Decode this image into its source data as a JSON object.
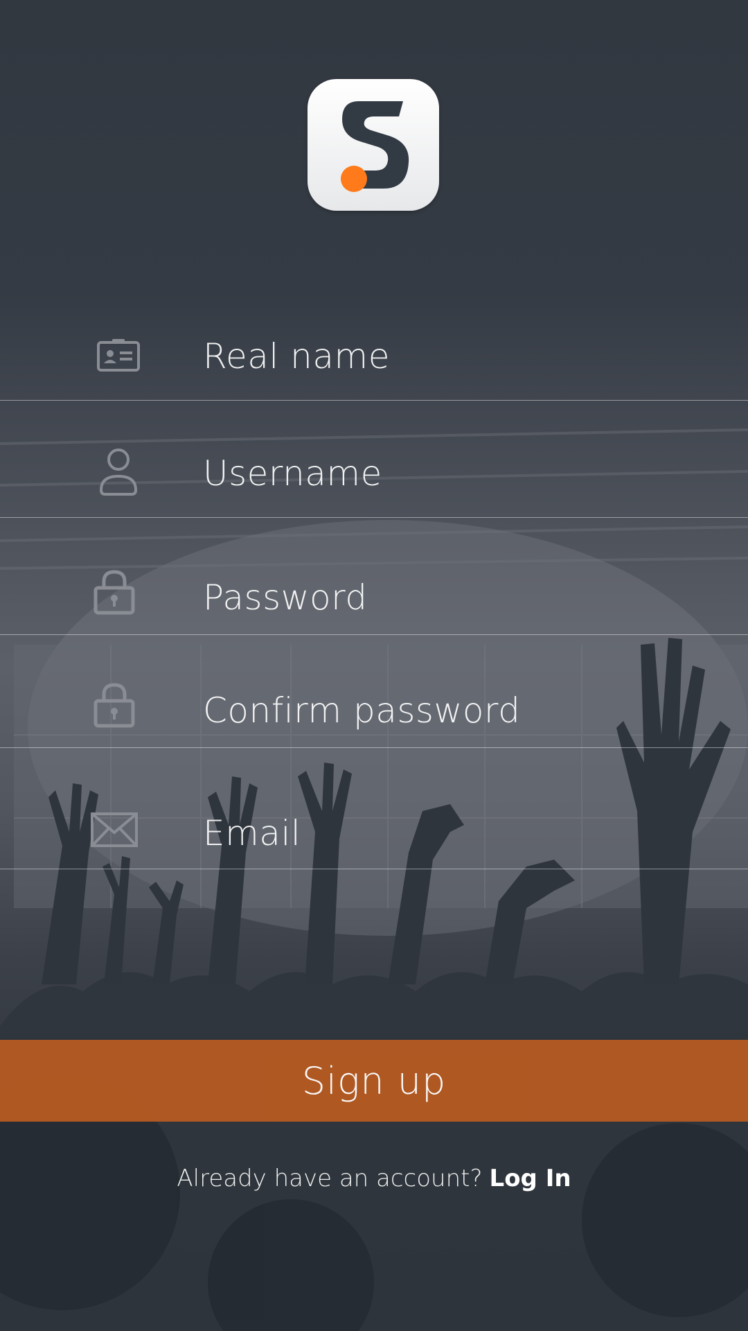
{
  "app": {
    "logo_letter": "S",
    "accent_color": "#ff7a1a",
    "button_color": "#b45a22"
  },
  "form": {
    "fields": [
      {
        "name": "real-name",
        "icon": "id-card-icon",
        "placeholder": "Real name"
      },
      {
        "name": "username",
        "icon": "user-icon",
        "placeholder": "Username"
      },
      {
        "name": "password",
        "icon": "lock-icon",
        "placeholder": "Password"
      },
      {
        "name": "confirm-password",
        "icon": "lock-icon",
        "placeholder": "Confirm password"
      },
      {
        "name": "email",
        "icon": "envelope-icon",
        "placeholder": "Email"
      }
    ]
  },
  "actions": {
    "signup_label": "Sign up",
    "login_prompt": "Already have an account?",
    "login_link": "Log In"
  }
}
